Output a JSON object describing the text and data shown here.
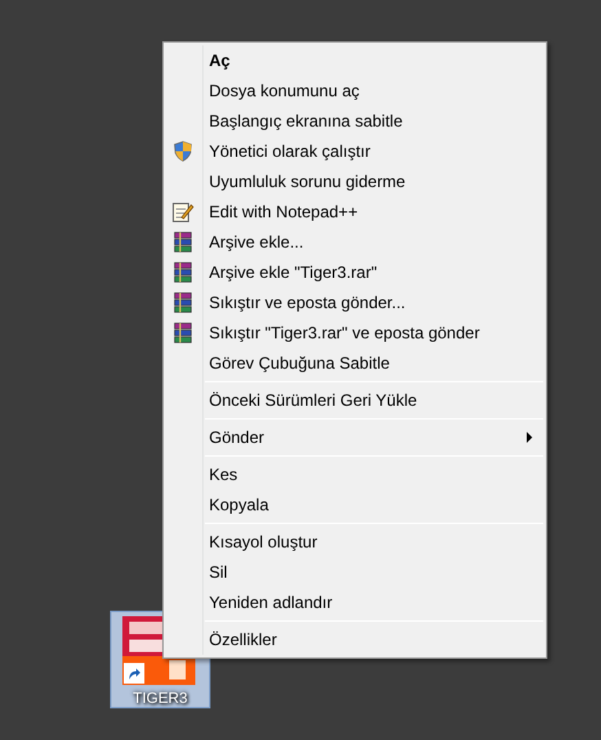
{
  "context_menu": {
    "items": [
      {
        "kind": "item",
        "label": "Aç",
        "default": true
      },
      {
        "kind": "item",
        "label": "Dosya konumunu aç"
      },
      {
        "kind": "item",
        "label": "Başlangıç ekranına sabitle"
      },
      {
        "kind": "shield_item",
        "label": "Yönetici olarak çalıştır"
      },
      {
        "kind": "item",
        "label": "Uyumluluk sorunu giderme"
      },
      {
        "kind": "notepad_item",
        "label": "Edit with Notepad++"
      },
      {
        "kind": "archive_item",
        "label": "Arşive ekle..."
      },
      {
        "kind": "archive_item",
        "label": "Arşive ekle \"Tiger3.rar\""
      },
      {
        "kind": "archive_item",
        "label": "Sıkıştır ve eposta gönder..."
      },
      {
        "kind": "archive_item",
        "label": "Sıkıştır \"Tiger3.rar\" ve eposta gönder"
      },
      {
        "kind": "item",
        "label": "Görev Çubuğuna Sabitle"
      },
      {
        "kind": "separator"
      },
      {
        "kind": "item",
        "label": "Önceki Sürümleri Geri Yükle"
      },
      {
        "kind": "separator"
      },
      {
        "kind": "item",
        "label": "Gönder",
        "submenu": true
      },
      {
        "kind": "separator"
      },
      {
        "kind": "item",
        "label": "Kes"
      },
      {
        "kind": "item",
        "label": "Kopyala"
      },
      {
        "kind": "separator"
      },
      {
        "kind": "item",
        "label": "Kısayol oluştur"
      },
      {
        "kind": "item",
        "label": "Sil"
      },
      {
        "kind": "item",
        "label": "Yeniden adlandır"
      },
      {
        "kind": "separator"
      },
      {
        "kind": "item",
        "label": "Özellikler"
      }
    ]
  },
  "desktop_icon": {
    "label": "TIGER3",
    "selected": true,
    "shortcut": true
  }
}
